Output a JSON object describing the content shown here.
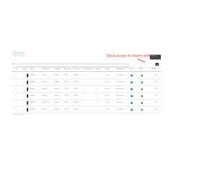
{
  "topbar": {
    "tag": "Back to list"
  },
  "callout": {
    "text": "Quick access to column settings"
  },
  "settings": {
    "label": "Settings"
  },
  "toolbar": {
    "filter_label": "Filter",
    "columns_icon": "≡"
  },
  "table": {
    "headers": [
      "ID",
      "Image",
      "Name",
      "Reference",
      "Category",
      "Base price",
      "Final price",
      "Quantity",
      "Status",
      "Position",
      "Carrier",
      "Manufacturer",
      "Icon",
      "Active",
      "Actions"
    ],
    "rows": [
      {
        "id": "1",
        "name": "Product",
        "ref": "demo_1",
        "cat": "Clothes",
        "base": "€23.90",
        "final": "€28.68",
        "qty": "1",
        "pos": "1",
        "carrier": "Carrier",
        "manu": "Manufacturer",
        "action": "Edit"
      },
      {
        "id": "2",
        "name": "Product",
        "ref": "demo_2",
        "cat": "Clothes",
        "base": "€35.90",
        "final": "€43.08",
        "qty": "1",
        "pos": "2",
        "carrier": "Carrier",
        "manu": "Manufacturer",
        "action": "Edit"
      },
      {
        "id": "3",
        "name": "Product",
        "ref": "demo_3",
        "cat": "Clothes",
        "base": "€29.00",
        "final": "€34.80",
        "qty": "1",
        "pos": "3",
        "carrier": "Carrier",
        "manu": "Manufacturer",
        "action": "Edit"
      },
      {
        "id": "4",
        "name": "Product",
        "ref": "demo_4",
        "cat": "Clothes",
        "base": "€29.00",
        "final": "€34.80",
        "qty": "1",
        "pos": "4",
        "carrier": "Carrier",
        "manu": "Manufacturer",
        "action": "Edit"
      },
      {
        "id": "5",
        "name": "Product",
        "ref": "demo_5",
        "cat": "Clothes",
        "base": "€29.00",
        "final": "€34.80",
        "qty": "1",
        "pos": "5",
        "carrier": "Carrier",
        "manu": "Manufacturer",
        "action": "Edit"
      },
      {
        "id": "6",
        "name": "Product",
        "ref": "demo_6",
        "cat": "Clothes",
        "base": "€11.90",
        "final": "€14.28",
        "qty": "1",
        "pos": "6",
        "carrier": "Carrier",
        "manu": "Manufacturer",
        "action": "Edit"
      }
    ]
  },
  "footer": {
    "text": "Showing 6 of 6"
  },
  "colors": {
    "accent": "#1e88c8",
    "callout": "#e0483a",
    "active": "#4caf50"
  }
}
